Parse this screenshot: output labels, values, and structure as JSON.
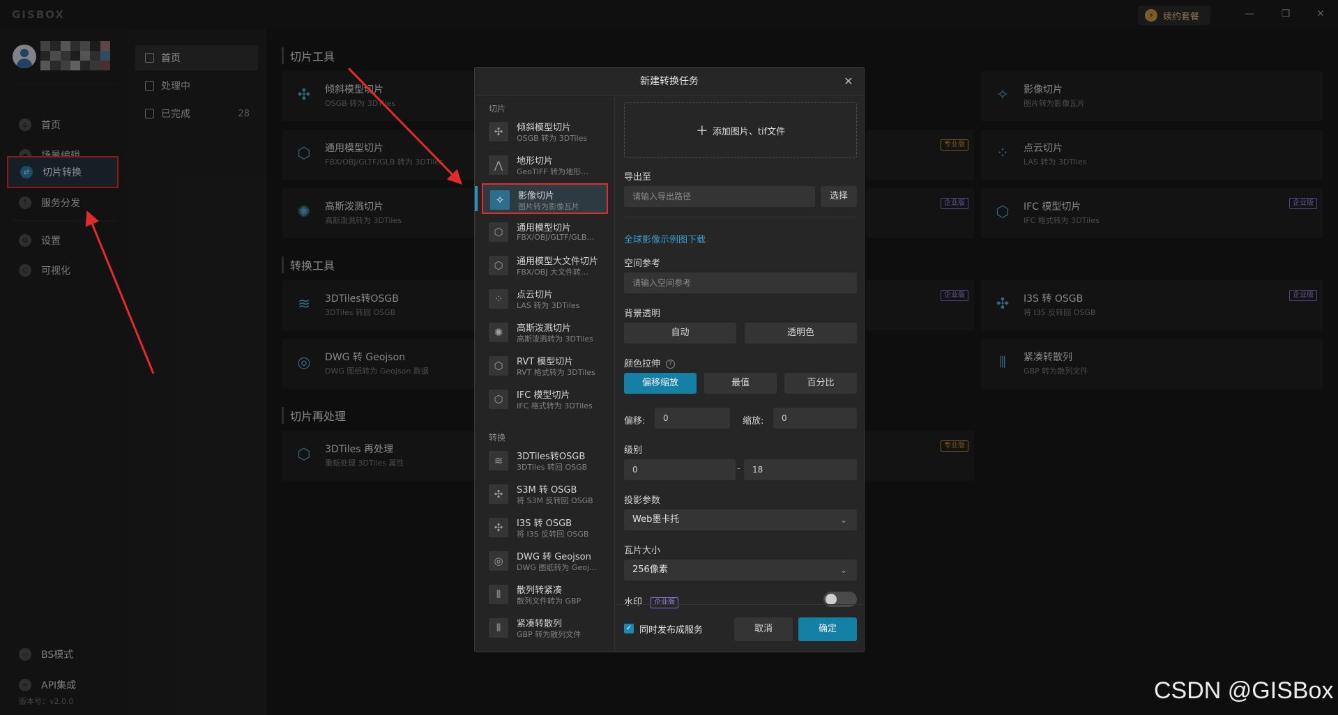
{
  "app": {
    "logo": "GISBOX",
    "renew_label": "续约套餐",
    "version": "版本号：v2.0.0"
  },
  "sidebar": {
    "items": [
      {
        "label": "首页"
      },
      {
        "label": "场景编辑"
      },
      {
        "label": "切片转换"
      },
      {
        "label": "服务分发"
      },
      {
        "label": "设置"
      },
      {
        "label": "可视化"
      },
      {
        "label": "BS模式"
      },
      {
        "label": "API集成"
      }
    ]
  },
  "subnav": {
    "items": [
      {
        "label": "首页"
      },
      {
        "label": "处理中"
      },
      {
        "label": "已完成",
        "count": "28"
      }
    ]
  },
  "main": {
    "sections": [
      "切片工具",
      "转换工具",
      "切片再处理"
    ],
    "cards": [
      {
        "title": "倾斜模型切片",
        "sub": "OSGB 转为 3DTiles"
      },
      {
        "title": "影像切片",
        "sub": "图片转为影像瓦片"
      },
      {
        "title": "通用模型切片",
        "sub": "FBX/OBJ/GLTF/GLB 转为 3DTiles"
      },
      {
        "title": "点云切片",
        "sub": "LAS 转为 3DTiles"
      },
      {
        "title": "高斯泼溅切片",
        "sub": "高斯泼溅转为 3DTiles"
      },
      {
        "title": "IFC 模型切片",
        "sub": "IFC 格式转为 3DTiles"
      },
      {
        "title": "3DTiles转OSGB",
        "sub": "3DTiles 转回 OSGB"
      },
      {
        "title": "I3S 转 OSGB",
        "sub": "将 I3S 反转回 OSGB"
      },
      {
        "title": "DWG 转 Geojson",
        "sub": "DWG 图纸转为 Geojson 数据"
      },
      {
        "title": "紧凑转散列",
        "sub": "GBP 转为散列文件"
      },
      {
        "title": "3DTiles 再处理",
        "sub": "重新处理 3DTiles 属性"
      }
    ],
    "badges": {
      "pro": "专业版",
      "ent": "企业版"
    }
  },
  "dialog": {
    "title": "新建转换任务",
    "cat_slice": "切片",
    "cat_convert": "转换",
    "slice_tools": [
      {
        "title": "倾斜模型切片",
        "sub": "OSGB 转为 3DTiles",
        "icon": "drone-icon"
      },
      {
        "title": "地形切片",
        "sub": "GeoTIFF 转为地形…",
        "icon": "terrain-icon"
      },
      {
        "title": "影像切片",
        "sub": "图片转为影像瓦片",
        "icon": "satellite-icon"
      },
      {
        "title": "通用模型切片",
        "sub": "FBX/OBJ/GLTF/GLB…",
        "icon": "cube-icon"
      },
      {
        "title": "通用模型大文件切片",
        "sub": "FBX/OBJ 大文件转…",
        "icon": "cube-icon"
      },
      {
        "title": "点云切片",
        "sub": "LAS 转为 3DTiles",
        "icon": "pointcloud-icon"
      },
      {
        "title": "高斯泼溅切片",
        "sub": "高斯泼溅转为 3DTiles",
        "icon": "gaussian-icon"
      },
      {
        "title": "RVT 模型切片",
        "sub": "RVT 格式转为 3DTiles",
        "icon": "cube-icon"
      },
      {
        "title": "IFC 模型切片",
        "sub": "IFC 格式转为 3DTiles",
        "icon": "cube-icon"
      }
    ],
    "convert_tools": [
      {
        "title": "3DTiles转OSGB",
        "sub": "3DTiles 转回 OSGB",
        "icon": "layers-icon"
      },
      {
        "title": "S3M 转 OSGB",
        "sub": "将 S3M 反转回 OSGB",
        "icon": "drone-icon"
      },
      {
        "title": "I3S 转 OSGB",
        "sub": "将 I3S 反转回 OSGB",
        "icon": "drone-icon"
      },
      {
        "title": "DWG 转 Geojson",
        "sub": "DWG 图纸转为 Geoj…",
        "icon": "target-icon"
      },
      {
        "title": "散列转紧凑",
        "sub": "散列文件转为 GBP",
        "icon": "barcode-icon"
      },
      {
        "title": "紧凑转散列",
        "sub": "GBP 转为散列文件",
        "icon": "barcode-icon"
      }
    ],
    "upload_label": "添加图片、tif文件",
    "export_label": "导出至",
    "export_placeholder": "请输入导出路径",
    "choose_label": "选择",
    "sample_link": "全球影像示例图下载",
    "srs_label": "空间参考",
    "srs_placeholder": "请输入空间参考",
    "bg_label": "背景透明",
    "bg_auto": "自动",
    "bg_color": "透明色",
    "stretch_label": "颜色拉伸",
    "stretch_opts": [
      "偏移缩放",
      "最值",
      "百分比"
    ],
    "offset_label": "偏移:",
    "offset_value": "0",
    "scale_label": "缩放:",
    "scale_value": "0",
    "level_label": "级别",
    "level_min": "0",
    "level_sep": "-",
    "level_max": "18",
    "proj_label": "投影参数",
    "proj_value": "Web墨卡托",
    "tile_label": "瓦片大小",
    "tile_value": "256像素",
    "watermark_label": "水印",
    "watermark_badge": "企业版",
    "publish_label": "同时发布成服务",
    "cancel_label": "取消",
    "ok_label": "确定"
  },
  "watermark_text": "CSDN @GISBox",
  "colors": {
    "accent": "#1580a6",
    "highlight": "#e42b2b",
    "pro": "#c28b3a",
    "enterprise": "#8a6ad8"
  }
}
